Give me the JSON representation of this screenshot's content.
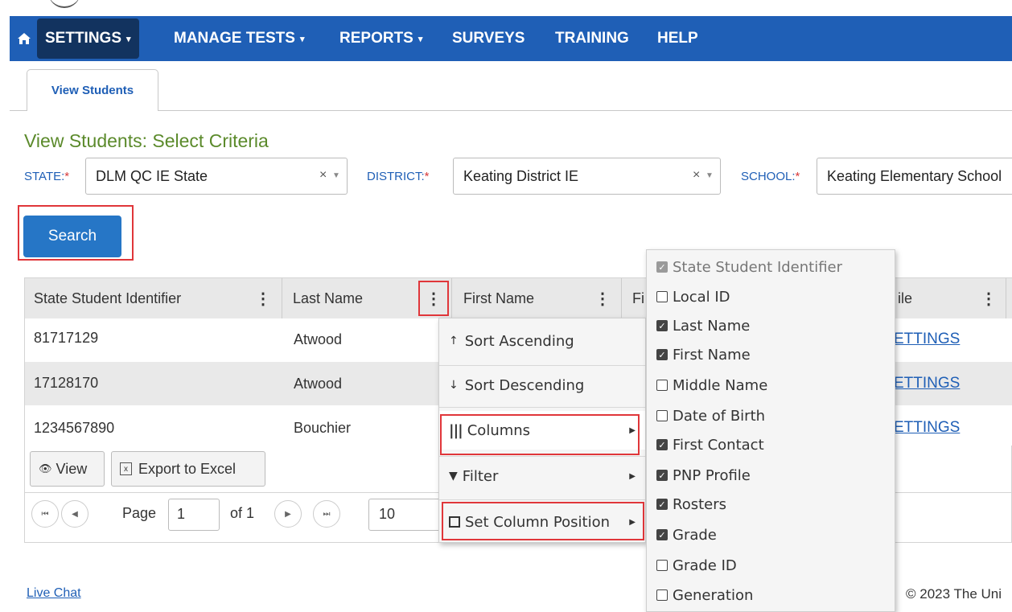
{
  "nav": {
    "items": [
      {
        "label": "SETTINGS",
        "caret": "▾"
      },
      {
        "label": "MANAGE TESTS",
        "caret": "▾"
      },
      {
        "label": "REPORTS",
        "caret": "▾"
      },
      {
        "label": "SURVEYS",
        "caret": ""
      },
      {
        "label": "TRAINING",
        "caret": ""
      },
      {
        "label": "HELP",
        "caret": ""
      }
    ]
  },
  "tab": {
    "label": "View Students"
  },
  "criteria": {
    "title": "View Students: Select Criteria",
    "state_label": "STATE:",
    "state_value": "DLM QC IE State",
    "district_label": "DISTRICT:",
    "district_value": "Keating District IE",
    "school_label": "SCHOOL:",
    "school_value": "Keating Elementary School",
    "required_mark": "*",
    "clear_glyph": "×",
    "caret_glyph": "▼"
  },
  "search_label": "Search",
  "grid": {
    "headers": [
      "State Student Identifier",
      "Last Name",
      "First Name",
      "Fi",
      "ile"
    ],
    "rows": [
      {
        "id": "81717129",
        "last": "Atwood",
        "link": "ETTINGS"
      },
      {
        "id": "17128170",
        "last": "Atwood",
        "link": "ETTINGS"
      },
      {
        "id": "1234567890",
        "last": "Bouchier",
        "link": "ETTINGS"
      }
    ],
    "view_label": "View",
    "export_label": "Export to Excel"
  },
  "pager": {
    "page_label": "Page",
    "page_value": "1",
    "of_label": "of 1",
    "page_size": "10"
  },
  "column_menu": {
    "sort_asc": "Sort Ascending",
    "sort_desc": "Sort Descending",
    "columns": "Columns",
    "filter": "Filter",
    "set_position": "Set Column Position"
  },
  "columns_submenu": [
    {
      "label": "State Student Identifier",
      "checked": true,
      "disabled": true
    },
    {
      "label": "Local ID",
      "checked": false
    },
    {
      "label": "Last Name",
      "checked": true
    },
    {
      "label": "First Name",
      "checked": true
    },
    {
      "label": "Middle Name",
      "checked": false
    },
    {
      "label": "Date of Birth",
      "checked": false
    },
    {
      "label": "First Contact",
      "checked": true
    },
    {
      "label": "PNP Profile",
      "checked": true
    },
    {
      "label": "Rosters",
      "checked": true
    },
    {
      "label": "Grade",
      "checked": true
    },
    {
      "label": "Grade ID",
      "checked": false
    },
    {
      "label": "Generation",
      "checked": false
    }
  ],
  "footer": {
    "live_chat": "Live Chat",
    "copyright": "© 2023 The Uni"
  },
  "colors": {
    "nav_bg": "#1f5fb6",
    "nav_active": "#12335f",
    "highlight": "#e0363a",
    "title_green": "#5b8a2b",
    "button_blue": "#2676c6"
  }
}
